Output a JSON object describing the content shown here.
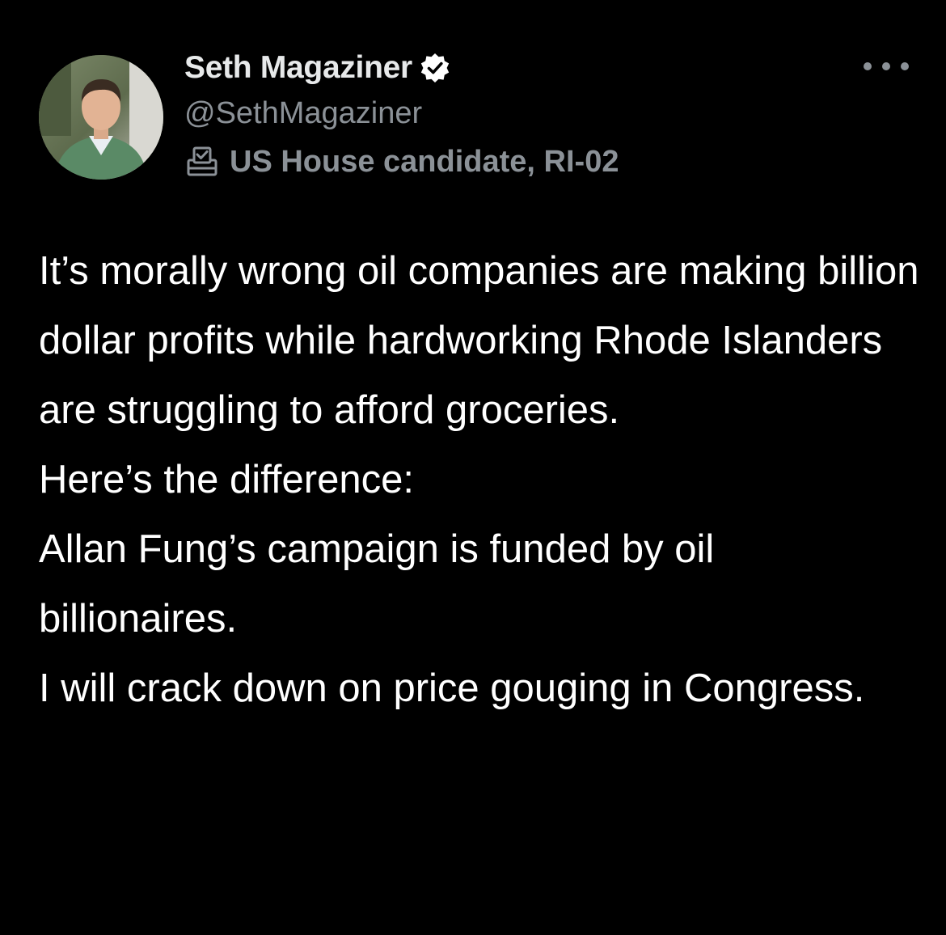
{
  "author": {
    "display_name": "Seth Magaziner",
    "handle": "@SethMagaziner",
    "affiliation": "US House candidate, RI-02",
    "verified": true,
    "verified_icon": "verified-badge-icon",
    "affiliation_icon": "ballot-box-icon"
  },
  "actions": {
    "more_icon": "more-options-icon"
  },
  "tweet": {
    "paragraphs": [
      "It’s morally wrong oil companies are making billion dollar profits while hardworking Rhode Islanders are struggling to afford groceries.",
      "Here’s the difference:",
      "Allan Fung’s campaign is funded by oil billionaires.",
      "I will crack down on price gouging in Congress."
    ]
  },
  "colors": {
    "background": "#000000",
    "primary_text": "#ffffff",
    "secondary_text": "#8b9197"
  }
}
